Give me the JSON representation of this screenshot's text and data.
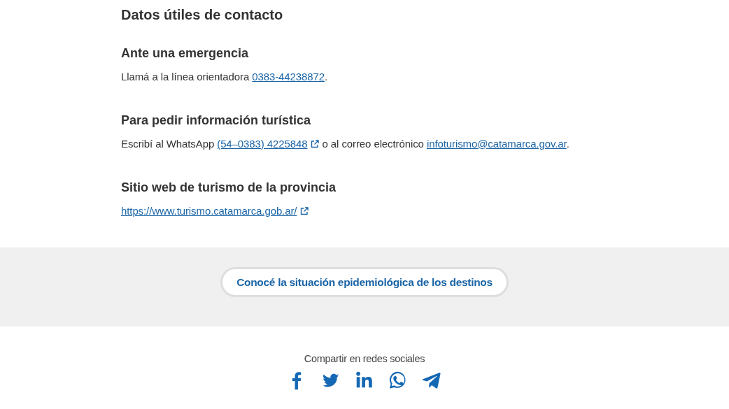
{
  "title": "Datos útiles de contacto",
  "sections": [
    {
      "heading": "Ante una emergencia",
      "parts": [
        {
          "kind": "text",
          "text": "Llamá a la línea orientadora "
        },
        {
          "kind": "link",
          "text": "0383-44238872",
          "external": false
        },
        {
          "kind": "text",
          "text": "."
        }
      ]
    },
    {
      "heading": "Para pedir información turística",
      "parts": [
        {
          "kind": "text",
          "text": "Escribí al WhatsApp "
        },
        {
          "kind": "link",
          "text": "(54–0383) 4225848",
          "external": true
        },
        {
          "kind": "text",
          "text": " o al correo electrónico "
        },
        {
          "kind": "link",
          "text": "infoturismo@catamarca.gov.ar",
          "external": false
        },
        {
          "kind": "text",
          "text": "."
        }
      ]
    },
    {
      "heading": "Sitio web de turismo de la provincia",
      "parts": [
        {
          "kind": "link",
          "text": "https://www.turismo.catamarca.gob.ar/",
          "external": true
        }
      ]
    }
  ],
  "cta_button": "Conocé la situación epidemiológica de los destinos",
  "share": {
    "label": "Compartir en redes sociales",
    "networks": [
      {
        "kind": "facebook"
      },
      {
        "kind": "twitter"
      },
      {
        "kind": "linkedin"
      },
      {
        "kind": "whatsapp"
      },
      {
        "kind": "telegram"
      }
    ]
  }
}
